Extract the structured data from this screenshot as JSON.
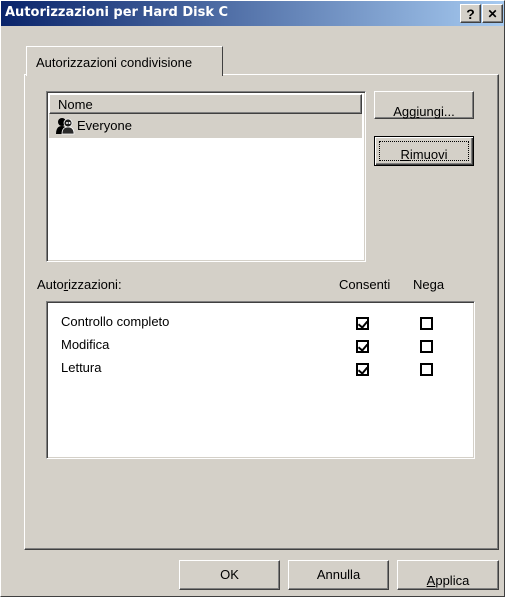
{
  "window": {
    "title": "Autorizzazioni per Hard Disk C"
  },
  "titlebar_buttons": {
    "help": "?",
    "close": "✕"
  },
  "tab": {
    "label": "Autorizzazioni condivisione"
  },
  "users_list": {
    "header": "Nome",
    "items": [
      {
        "name": "Everyone",
        "icon": "users-group-icon",
        "selected": true
      }
    ]
  },
  "buttons": {
    "add": {
      "pre": "Agg",
      "u": "i",
      "post": "ungi..."
    },
    "remove": {
      "pre": "",
      "u": "R",
      "post": "imuovi"
    },
    "ok": "OK",
    "cancel": "Annulla",
    "apply": {
      "pre": "",
      "u": "A",
      "post": "pplica"
    }
  },
  "permissions": {
    "label": {
      "pre": "Auto",
      "u": "r",
      "post": "izzazioni:"
    },
    "col_allow": "Consenti",
    "col_deny": "Nega",
    "rows": [
      {
        "name": "Controllo completo",
        "allow": true,
        "deny": false
      },
      {
        "name": "Modifica",
        "allow": true,
        "deny": false
      },
      {
        "name": "Lettura",
        "allow": true,
        "deny": false
      }
    ]
  },
  "colors": {
    "face": "#d4d0c8",
    "title_start": "#0a246a",
    "title_end": "#a6caf0"
  }
}
